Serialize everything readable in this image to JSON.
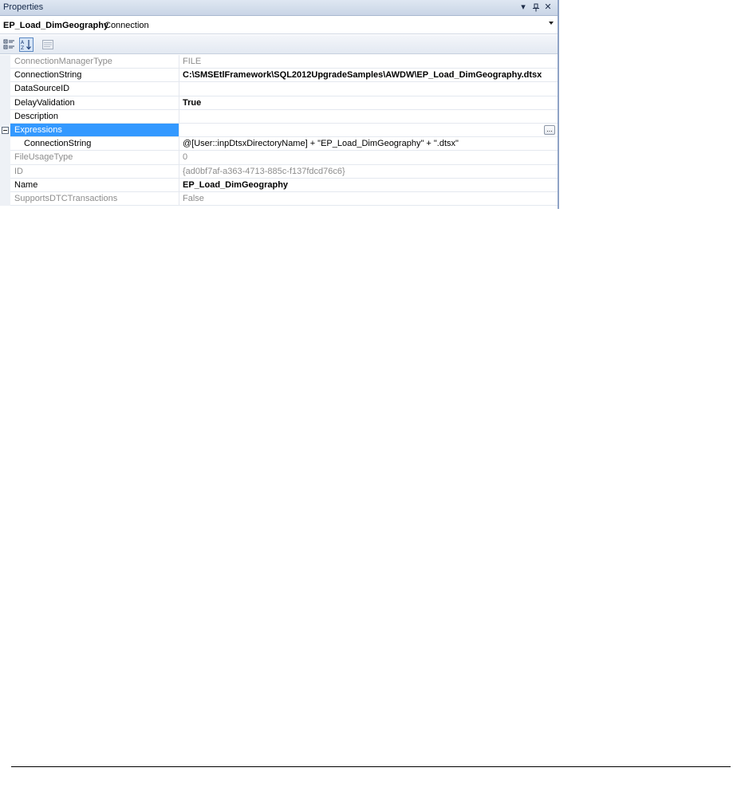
{
  "panel": {
    "title": "Properties",
    "pin_glyph": "▾",
    "autohide_glyph": "⊥",
    "close_glyph": "✕"
  },
  "object_selector": {
    "name": "EP_Load_DimGeography",
    "type": "Connection"
  },
  "toolbar": {
    "buttons": [
      {
        "icon": "categorized-icon",
        "active": false
      },
      {
        "icon": "alphabetical-sort-icon",
        "active": true
      },
      {
        "icon": "property-pages-icon",
        "active": false
      }
    ]
  },
  "properties": [
    {
      "name": "ConnectionManagerType",
      "value": "FILE"
    },
    {
      "name": "ConnectionString",
      "value": "C:\\SMSEtlFramework\\SQL2012UpgradeSamples\\AWDW\\EP_Load_DimGeography.dtsx"
    },
    {
      "name": "DataSourceID",
      "value": ""
    },
    {
      "name": "DelayValidation",
      "value": "True"
    },
    {
      "name": "Description",
      "value": ""
    },
    {
      "name": "Expressions",
      "value": "",
      "ellipsis": "..."
    },
    {
      "name": "ConnectionString",
      "value": "@[User::inpDtsxDirectoryName] + \"EP_Load_DimGeography\" + \".dtsx\""
    },
    {
      "name": "FileUsageType",
      "value": "0"
    },
    {
      "name": "ID",
      "value": "{ad0bf7af-a363-4713-885c-f137fdcd76c6}"
    },
    {
      "name": "Name",
      "value": "EP_Load_DimGeography"
    },
    {
      "name": "SupportsDTCTransactions",
      "value": "False"
    }
  ],
  "colors": {
    "selection": "#3399ff",
    "readonly_text": "#8d8d8d",
    "titlebar": "#c9d5e6"
  }
}
